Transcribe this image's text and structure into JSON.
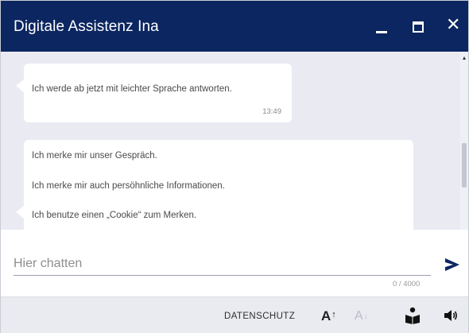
{
  "window": {
    "title": "Digitale Assistenz Ina",
    "accent_color": "#0b2660"
  },
  "messages": [
    {
      "lines": [
        "Ich werde ab jetzt mit leichter Sprache antworten."
      ],
      "time": "13:49"
    },
    {
      "lines": [
        "Ich merke mir unser Gespräch.",
        "Ich merke mir auch persöhnliche Informationen.",
        "Ich benutze einen „Cookie“ zum Merken."
      ]
    }
  ],
  "input": {
    "placeholder": "Hier chatten",
    "value": "",
    "counter": "0 / 4000"
  },
  "toolbar": {
    "privacy_label": "DATENSCHUTZ",
    "font_increase_icon": "text-size-increase-icon",
    "font_decrease_icon": "text-size-decrease-icon",
    "reader_icon": "reading-person-icon",
    "speaker_icon": "speaker-icon",
    "font_letter": "A"
  }
}
